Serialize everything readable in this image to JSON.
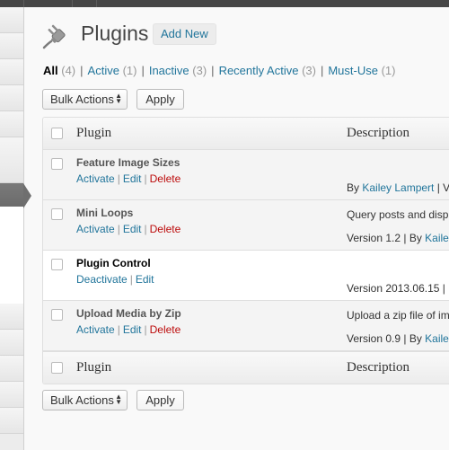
{
  "page": {
    "title": "Plugins",
    "add_new": "Add New"
  },
  "filters": [
    {
      "label": "All",
      "count": "(4)"
    },
    {
      "label": "Active",
      "count": "(1)"
    },
    {
      "label": "Inactive",
      "count": "(3)"
    },
    {
      "label": "Recently Active",
      "count": "(3)"
    },
    {
      "label": "Must-Use",
      "count": "(1)"
    }
  ],
  "filter_separator": "|",
  "tablenav": {
    "bulk_label": "Bulk Actions",
    "apply_label": "Apply"
  },
  "table": {
    "columns": {
      "plugin": "Plugin",
      "description": "Description"
    },
    "rows": [
      {
        "name": "Feature Image Sizes",
        "status": "inactive",
        "actions": [
          "Activate",
          "Edit",
          "Delete"
        ],
        "description": "",
        "meta_prefix": "By ",
        "meta_link": "Kailey Lampert",
        "meta_suffix": " | V"
      },
      {
        "name": "Mini Loops",
        "status": "inactive",
        "actions": [
          "Activate",
          "Edit",
          "Delete"
        ],
        "description": "Query posts and disp",
        "meta_prefix": "Version 1.2 | By ",
        "meta_link": "Kaile",
        "meta_suffix": ""
      },
      {
        "name": "Plugin Control",
        "status": "active",
        "actions": [
          "Deactivate",
          "Edit"
        ],
        "description": "",
        "meta_prefix": "Version 2013.06.15 |",
        "meta_link": "",
        "meta_suffix": ""
      },
      {
        "name": "Upload Media by Zip",
        "status": "inactive",
        "actions": [
          "Activate",
          "Edit",
          "Delete"
        ],
        "description": "Upload a zip file of im",
        "meta_prefix": "Version 0.9 | By ",
        "meta_link": "Kaile",
        "meta_suffix": ""
      }
    ]
  },
  "icons": {
    "page_icon": "plug-icon",
    "select_arrows": "updown-arrows-icon"
  },
  "colors": {
    "link": "#21759b",
    "delete": "#bc0b0b",
    "current_menu": "#6f6f6f"
  }
}
